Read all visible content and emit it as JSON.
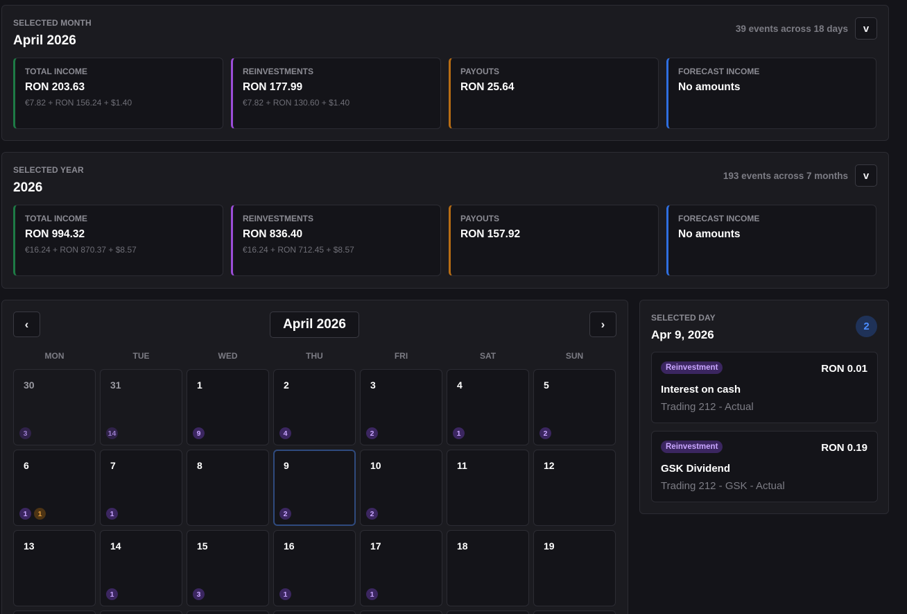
{
  "month_panel": {
    "label": "SELECTED MONTH",
    "title": "April 2026",
    "meta": "39 events across 18 days",
    "toggle": "v",
    "cards": [
      {
        "title": "TOTAL INCOME",
        "value": "RON 203.63",
        "sub": "€7.82 + RON 156.24 + $1.40",
        "color": "#1e7a45"
      },
      {
        "title": "REINVESTMENTS",
        "value": "RON 177.99",
        "sub": "€7.82 + RON 130.60 + $1.40",
        "color": "#9b4dd8"
      },
      {
        "title": "PAYOUTS",
        "value": "RON 25.64",
        "sub": "",
        "color": "#b86d14"
      },
      {
        "title": "FORECAST INCOME",
        "value": "No amounts",
        "sub": "",
        "color": "#2f6fe0"
      }
    ]
  },
  "year_panel": {
    "label": "SELECTED YEAR",
    "title": "2026",
    "meta": "193 events across 7 months",
    "toggle": "v",
    "cards": [
      {
        "title": "TOTAL INCOME",
        "value": "RON 994.32",
        "sub": "€16.24 + RON 870.37 + $8.57",
        "color": "#1e7a45"
      },
      {
        "title": "REINVESTMENTS",
        "value": "RON 836.40",
        "sub": "€16.24 + RON 712.45 + $8.57",
        "color": "#9b4dd8"
      },
      {
        "title": "PAYOUTS",
        "value": "RON 157.92",
        "sub": "",
        "color": "#b86d14"
      },
      {
        "title": "FORECAST INCOME",
        "value": "No amounts",
        "sub": "",
        "color": "#2f6fe0"
      }
    ]
  },
  "calendar": {
    "title": "April 2026",
    "prev": "‹",
    "next": "›",
    "weekdays": [
      "MON",
      "TUE",
      "WED",
      "THU",
      "FRI",
      "SAT",
      "SUN"
    ],
    "rows": [
      [
        {
          "day": "30",
          "outside": true,
          "badges": [
            {
              "n": "3",
              "kind": "purple"
            }
          ]
        },
        {
          "day": "31",
          "outside": true,
          "badges": [
            {
              "n": "14",
              "kind": "purple"
            }
          ]
        },
        {
          "day": "1",
          "badges": [
            {
              "n": "9",
              "kind": "purple"
            }
          ]
        },
        {
          "day": "2",
          "badges": [
            {
              "n": "4",
              "kind": "purple"
            }
          ]
        },
        {
          "day": "3",
          "badges": [
            {
              "n": "2",
              "kind": "purple"
            }
          ]
        },
        {
          "day": "4",
          "badges": [
            {
              "n": "1",
              "kind": "purple"
            }
          ]
        },
        {
          "day": "5",
          "badges": [
            {
              "n": "2",
              "kind": "purple"
            }
          ]
        }
      ],
      [
        {
          "day": "6",
          "badges": [
            {
              "n": "1",
              "kind": "purple"
            },
            {
              "n": "1",
              "kind": "orange"
            }
          ]
        },
        {
          "day": "7",
          "badges": [
            {
              "n": "1",
              "kind": "purple"
            }
          ]
        },
        {
          "day": "8",
          "badges": []
        },
        {
          "day": "9",
          "selected": true,
          "badges": [
            {
              "n": "2",
              "kind": "purple"
            }
          ]
        },
        {
          "day": "10",
          "badges": [
            {
              "n": "2",
              "kind": "purple"
            }
          ]
        },
        {
          "day": "11",
          "badges": []
        },
        {
          "day": "12",
          "badges": []
        }
      ],
      [
        {
          "day": "13",
          "badges": []
        },
        {
          "day": "14",
          "badges": [
            {
              "n": "1",
              "kind": "purple"
            }
          ]
        },
        {
          "day": "15",
          "badges": [
            {
              "n": "3",
              "kind": "purple"
            }
          ]
        },
        {
          "day": "16",
          "badges": [
            {
              "n": "1",
              "kind": "purple"
            }
          ]
        },
        {
          "day": "17",
          "badges": [
            {
              "n": "1",
              "kind": "purple"
            }
          ]
        },
        {
          "day": "18",
          "badges": []
        },
        {
          "day": "19",
          "badges": []
        }
      ]
    ]
  },
  "selected_day": {
    "label": "SELECTED DAY",
    "title": "Apr 9, 2026",
    "count": "2",
    "events": [
      {
        "tag": "Reinvestment",
        "amount": "RON 0.01",
        "name": "Interest on cash",
        "source": "Trading 212 - Actual"
      },
      {
        "tag": "Reinvestment",
        "amount": "RON 0.19",
        "name": "GSK Dividend",
        "source": "Trading 212 - GSK - Actual"
      }
    ]
  }
}
